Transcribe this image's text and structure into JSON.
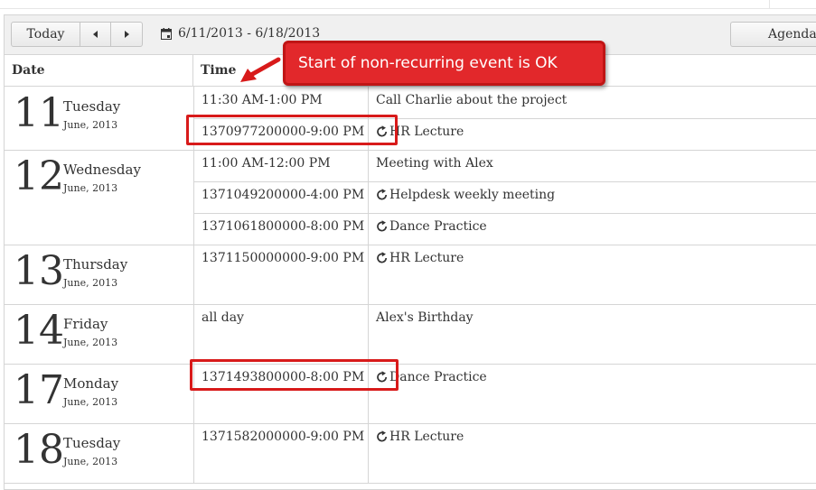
{
  "toolbar": {
    "today_label": "Today",
    "date_range": "6/11/2013 - 6/18/2013",
    "view_label": "Agenda"
  },
  "columns": {
    "date": "Date",
    "time": "Time"
  },
  "days": [
    {
      "num": "11",
      "name": "Tuesday",
      "month": "June, 2013"
    },
    {
      "num": "12",
      "name": "Wednesday",
      "month": "June, 2013"
    },
    {
      "num": "13",
      "name": "Thursday",
      "month": "June, 2013"
    },
    {
      "num": "14",
      "name": "Friday",
      "month": "June, 2013"
    },
    {
      "num": "17",
      "name": "Monday",
      "month": "June, 2013"
    },
    {
      "num": "18",
      "name": "Tuesday",
      "month": "June, 2013"
    }
  ],
  "events": [
    {
      "time": "11:30 AM-1:00 PM",
      "title": "Call Charlie about the project",
      "recurring": false
    },
    {
      "time": "1370977200000-9:00 PM",
      "title": "HR Lecture",
      "recurring": true
    },
    {
      "time": "11:00 AM-12:00 PM",
      "title": "Meeting with Alex",
      "recurring": false
    },
    {
      "time": "1371049200000-4:00 PM",
      "title": "Helpdesk weekly meeting",
      "recurring": true
    },
    {
      "time": "1371061800000-8:00 PM",
      "title": "Dance Practice",
      "recurring": true
    },
    {
      "time": "1371150000000-9:00 PM",
      "title": "HR Lecture",
      "recurring": true
    },
    {
      "time": "all day",
      "title": "Alex's Birthday",
      "recurring": false
    },
    {
      "time": "1371493800000-8:00 PM",
      "title": "Dance Practice",
      "recurring": true
    },
    {
      "time": "1371582000000-9:00 PM",
      "title": "HR Lecture",
      "recurring": true
    }
  ],
  "annotation": {
    "text": "Start of non-recurring event is OK",
    "color": "#e2282b"
  },
  "icons": {
    "calendar": "calendar-icon",
    "recurrence": "recurrence-icon",
    "prev": "prev-arrow-icon",
    "next": "next-arrow-icon"
  }
}
